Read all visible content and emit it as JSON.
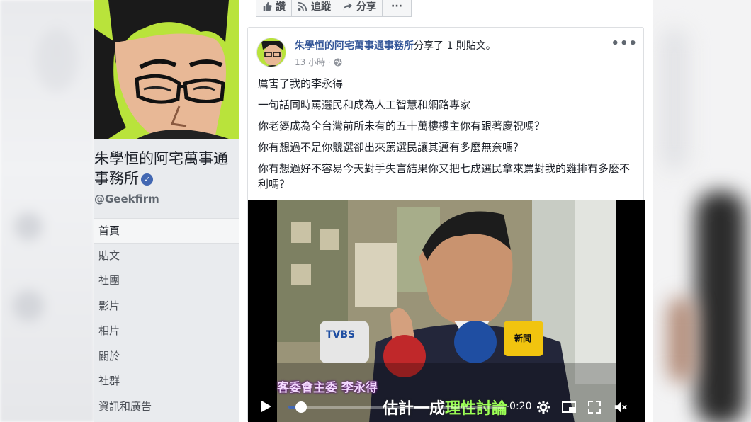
{
  "page": {
    "name": "朱學恒的阿宅萬事通事務所",
    "handle": "@Geekfirm",
    "verified_icon": "check-icon"
  },
  "nav": [
    {
      "label": "首頁",
      "active": true
    },
    {
      "label": "貼文",
      "active": false
    },
    {
      "label": "社團",
      "active": false
    },
    {
      "label": "影片",
      "active": false
    },
    {
      "label": "相片",
      "active": false
    },
    {
      "label": "關於",
      "active": false
    },
    {
      "label": "社群",
      "active": false
    },
    {
      "label": "資訊和廣告",
      "active": false
    }
  ],
  "action_bar": {
    "like": "讚",
    "follow": "追蹤",
    "share": "分享",
    "more": "···"
  },
  "post": {
    "author": "朱學恒的阿宅萬事通事務所",
    "shared_text": "分享了 1 則貼文。",
    "time": "13 小時 · ",
    "more": "•••",
    "lines": [
      "厲害了我的李永得",
      "一句話同時罵選民和成為人工智慧和網路專家",
      "你老婆成為全台灣前所未有的五十萬樓樓主你有跟著慶祝嗎？",
      "你有想過不是你競選卻出來罵選民讓其邁有多麼無奈嗎？",
      "你有想過好不容易今天對手失言結果你又把七成選民拿來罵對我的雞排有多麼不利嗎？"
    ]
  },
  "video": {
    "caption_left": "客委會主委 李永得",
    "caption_right_a": "估計",
    "caption_right_b": "一成",
    "caption_right_c": "理性討論",
    "mic_tvbs": "TVBS",
    "mic_new": "新聞",
    "time_remaining": "-0:20",
    "progress_fraction": 0.06
  },
  "colors": {
    "brand_blue": "#4267b2",
    "link_blue": "#365899",
    "cover_green": "#b9e33b"
  }
}
